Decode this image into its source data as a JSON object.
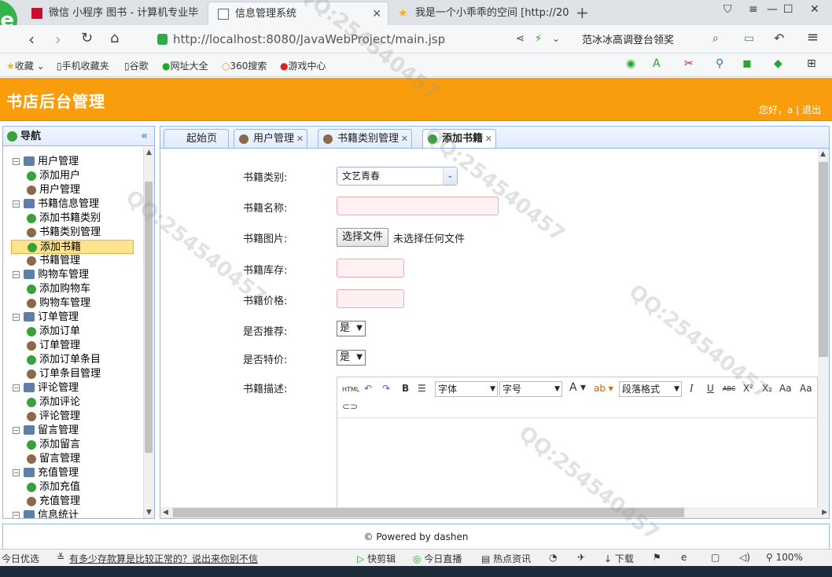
{
  "browser": {
    "tabs": [
      {
        "title": "微信 小程序 图书 - 计算机专业毕",
        "color": "#c8102e"
      },
      {
        "title": "信息管理系统",
        "color": "#666666"
      },
      {
        "title": "我是一个小乖乖的空间 [http://20",
        "color": "#f5b400"
      }
    ],
    "new_tab_icon": "plus-icon",
    "url_host": "http://localhost",
    "url_rest": ":8080/JavaWebProject/main.jsp",
    "search_text": "范冰冰高调登台领奖",
    "bookmarks": [
      "收藏",
      "手机收藏夹",
      "谷歌",
      "网址大全",
      "360搜索",
      "游戏中心"
    ]
  },
  "header": {
    "title": "书店后台管理",
    "greeting": "您好，a | 退出"
  },
  "sidebar": {
    "title": "导航",
    "collapse_icon": "double-chevron-left-icon",
    "groups": [
      {
        "label": "用户管理",
        "items": [
          {
            "label": "添加用户",
            "icon": "add"
          },
          {
            "label": "用户管理",
            "icon": "user"
          }
        ]
      },
      {
        "label": "书籍信息管理",
        "items": [
          {
            "label": "添加书籍类别",
            "icon": "add"
          },
          {
            "label": "书籍类别管理",
            "icon": "user"
          },
          {
            "label": "添加书籍",
            "icon": "add",
            "selected": true
          },
          {
            "label": "书籍管理",
            "icon": "user"
          }
        ]
      },
      {
        "label": "购物车管理",
        "items": [
          {
            "label": "添加购物车",
            "icon": "add"
          },
          {
            "label": "购物车管理",
            "icon": "user"
          }
        ]
      },
      {
        "label": "订单管理",
        "items": [
          {
            "label": "添加订单",
            "icon": "add"
          },
          {
            "label": "订单管理",
            "icon": "user"
          },
          {
            "label": "添加订单条目",
            "icon": "add"
          },
          {
            "label": "订单条目管理",
            "icon": "user"
          }
        ]
      },
      {
        "label": "评论管理",
        "items": [
          {
            "label": "添加评论",
            "icon": "add"
          },
          {
            "label": "评论管理",
            "icon": "user"
          }
        ]
      },
      {
        "label": "留言管理",
        "items": [
          {
            "label": "添加留言",
            "icon": "add"
          },
          {
            "label": "留言管理",
            "icon": "user"
          }
        ]
      },
      {
        "label": "充值管理",
        "items": [
          {
            "label": "添加充值",
            "icon": "add"
          },
          {
            "label": "充值管理",
            "icon": "user"
          }
        ]
      },
      {
        "label": "信息统计",
        "items": []
      }
    ]
  },
  "tabs": [
    {
      "label": "起始页",
      "closable": false
    },
    {
      "label": "用户管理",
      "closable": true
    },
    {
      "label": "书籍类别管理",
      "closable": true
    },
    {
      "label": "添加书籍",
      "closable": true,
      "active": true
    }
  ],
  "form": {
    "category_label": "书籍类别:",
    "category_value": "文艺青春",
    "name_label": "书籍名称:",
    "image_label": "书籍图片:",
    "file_button": "选择文件",
    "file_hint": "未选择任何文件",
    "stock_label": "书籍库存:",
    "price_label": "书籍价格:",
    "recommend_label": "是否推荐:",
    "recommend_value": "是",
    "special_label": "是否特价:",
    "special_value": "是",
    "desc_label": "书籍描述:"
  },
  "editor": {
    "html_btn": "HTML",
    "font_family": "字体",
    "font_size": "字号",
    "paragraph": "段落格式",
    "bold": "B",
    "italic": "I",
    "underline": "U",
    "strike": "ABC",
    "sup": "X²",
    "sub": "X₂",
    "font_color": "A"
  },
  "footer": {
    "text": "© Powered by dashen"
  },
  "statusbar": {
    "left": "今日优选",
    "news": "有多少存款算是比较正常的？说出来你别不信",
    "items": [
      "快剪辑",
      "今日直播",
      "热点资讯",
      "下载"
    ],
    "zoom": "100%"
  },
  "colors": {
    "header": "#f99d0c",
    "border": "#95b8e7",
    "selected": "#ffe48d"
  }
}
